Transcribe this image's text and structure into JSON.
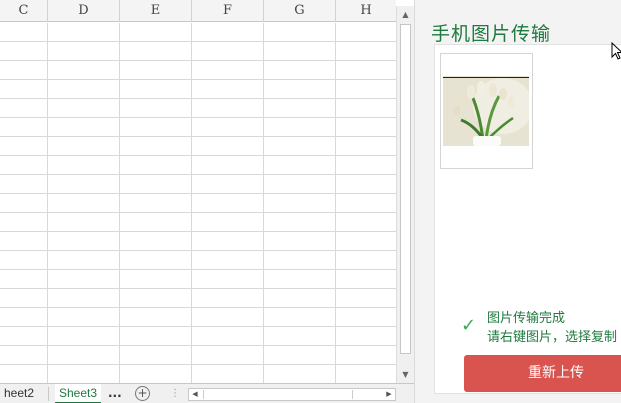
{
  "spreadsheet": {
    "columns": [
      "C",
      "D",
      "E",
      "F",
      "G",
      "H"
    ]
  },
  "tabs": {
    "items": [
      "heet2",
      "Sheet3"
    ],
    "more_label": "...",
    "add_label": "+"
  },
  "panel": {
    "title": "手机图片传输",
    "status_line1": "图片传输完成",
    "status_line2": "请右键图片，选择复制",
    "reupload_label": "重新上传"
  },
  "colors": {
    "accent_green": "#1f7a3f",
    "button_red": "#d9534f",
    "check_green": "#3aa655"
  },
  "icons": {
    "check": "check-icon",
    "add_sheet": "plus-circle-icon",
    "cursor": "mouse-pointer-icon"
  }
}
